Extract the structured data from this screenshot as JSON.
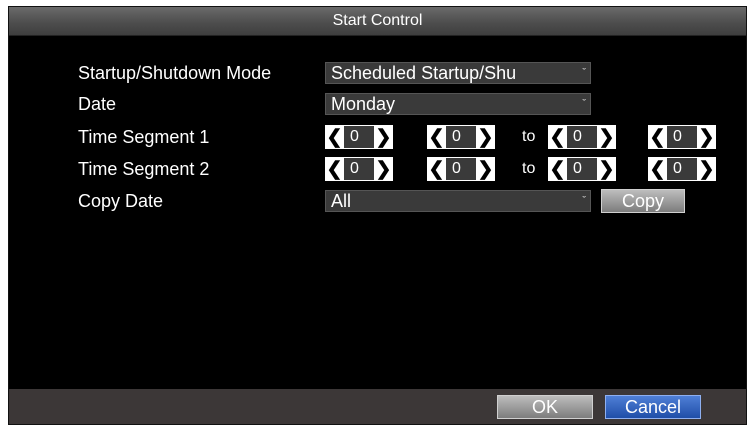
{
  "dialog": {
    "title": "Start Control"
  },
  "rows": {
    "mode": {
      "label": "Startup/Shutdown Mode",
      "value": "Scheduled Startup/Shu"
    },
    "date": {
      "label": "Date",
      "value": "Monday"
    },
    "seg1": {
      "label": "Time Segment 1",
      "values": [
        "0",
        "0",
        "0",
        "0"
      ],
      "to": "to"
    },
    "seg2": {
      "label": "Time Segment 2",
      "values": [
        "0",
        "0",
        "0",
        "0"
      ],
      "to": "to"
    },
    "copy": {
      "label": "Copy Date",
      "value": "All",
      "button": "Copy"
    }
  },
  "footer": {
    "ok": "OK",
    "cancel": "Cancel"
  },
  "glyphs": {
    "left": "❮",
    "right": "❯",
    "caret": "ˇ"
  },
  "colors": {
    "cancel_accent": "#1f4ea8",
    "panel": "#000000",
    "title_bar": "#555555"
  }
}
